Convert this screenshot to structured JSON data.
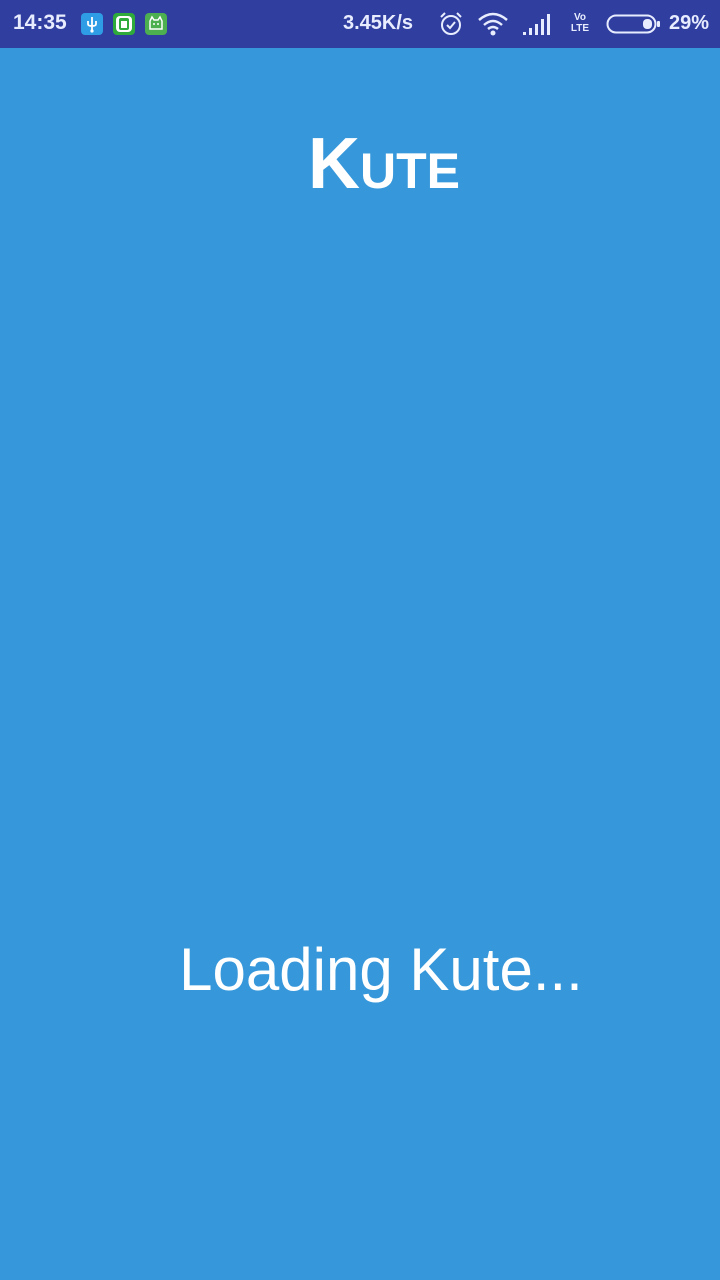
{
  "status_bar": {
    "time": "14:35",
    "network_speed": "3.45K/s",
    "volte_top": "Vo",
    "volte_bottom": "LTE",
    "battery_percent": "29%",
    "battery_level": 0.29,
    "notification_icons": [
      "usb-icon",
      "cleaner-icon",
      "android-cat-icon"
    ],
    "system_icons": [
      "alarm-icon",
      "wifi-icon",
      "signal-icon",
      "volte-icon",
      "battery-icon"
    ]
  },
  "app": {
    "title": "Kute",
    "loading_message": "Loading Kute..."
  },
  "colors": {
    "background": "#3698db",
    "status_bar": "#303f9f",
    "text": "#ffffff"
  }
}
